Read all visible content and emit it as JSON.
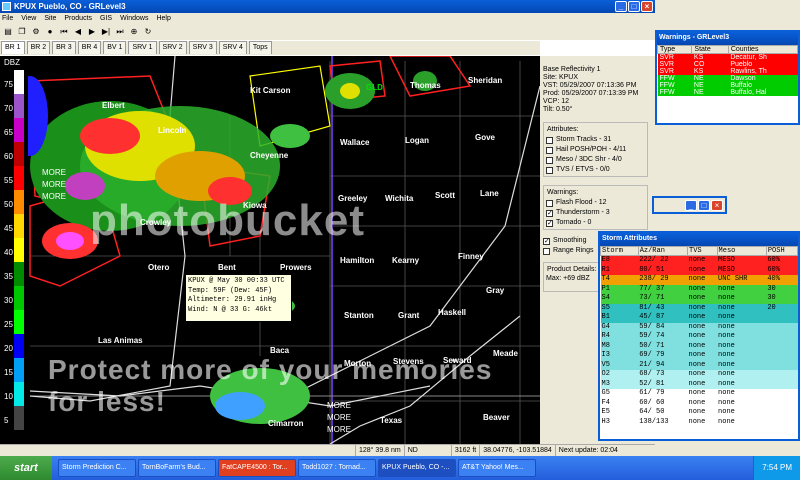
{
  "window": {
    "title": "KPUX Pueblo, CO - GRLevel3"
  },
  "menu": [
    "File",
    "View",
    "Site",
    "Products",
    "GIS",
    "Windows",
    "Help"
  ],
  "tabs": [
    "BR 1",
    "BR 2",
    "BR 3",
    "BR 4",
    "BV 1",
    "SRV 1",
    "SRV 2",
    "SRV 3",
    "SRV 4",
    "Tops"
  ],
  "colorbar": {
    "unit": "DBZ",
    "ticks": [
      "75",
      "70",
      "65",
      "60",
      "55",
      "50",
      "45",
      "40",
      "35",
      "30",
      "25",
      "20",
      "15",
      "10",
      "5"
    ]
  },
  "counties": [
    "Kit Carson",
    "Elbert",
    "Lincoln",
    "Cheyenne",
    "Wallace",
    "Logan",
    "Gove",
    "Thomas",
    "Sheridan",
    "Greeley",
    "Wichita",
    "Scott",
    "Lane",
    "Crowley",
    "Kiowa",
    "Otero",
    "Bent",
    "Prowers",
    "Hamilton",
    "Kearny",
    "Finney",
    "Gray",
    "Stanton",
    "Grant",
    "Haskell",
    "Las Animas",
    "Baca",
    "Morton",
    "Stevens",
    "Seward",
    "Meade",
    "Cimarron",
    "Texas",
    "Beaver"
  ],
  "map_cities": [
    "GLD"
  ],
  "tooltip": {
    "line1": "KPUX @ May 30 00:33 UTC",
    "line2": "Temp: 59F (Dew: 45F)",
    "line3": "Altimeter: 29.91 inHg",
    "line4": "Wind: N @ 33 G: 46kt"
  },
  "side": {
    "product": "Base Reflectivity 1",
    "site": "Site:  KPUX",
    "vst": "VST:  05/29/2007 07:13:36 PM",
    "prod": "Prod: 05/29/2007 07:13:39 PM",
    "vcp": "VCP:  12",
    "tilt": "Tilt:  0.50°",
    "attributes_caption": "Attributes:",
    "attributes": [
      "Storm Tracks - 31",
      "Hail POSH/POH - 4/11",
      "Meso / 3DC Shr - 4/0",
      "TVS / ETVS - 0/0"
    ],
    "warnings_caption": "Warnings:",
    "warnings": [
      "Flash Flood - 12",
      "Thunderstorm - 3",
      "Tornado - 0"
    ],
    "warnings_checked": [
      false,
      true,
      true
    ],
    "smoothing": "Smoothing",
    "range_rings": "Range Rings",
    "details_caption": "Product Details:",
    "details_max": "Max:  +69 dBZ"
  },
  "status": [
    "128° 39.8 nm",
    "ND",
    "3162 ft",
    "38.04776, -103.51884",
    "Next update: 02:04"
  ],
  "warnings_window": {
    "title": "Warnings - GRLevel3",
    "headers": [
      "Type",
      "State",
      "Counties"
    ],
    "rows": [
      {
        "type": "SVR",
        "state": "KS",
        "counties": "Decatur, Sh",
        "color": "#ff0000"
      },
      {
        "type": "SVR",
        "state": "CO",
        "counties": "Pueblo",
        "color": "#ff0000"
      },
      {
        "type": "SVR",
        "state": "KS",
        "counties": "Rawlins, Th",
        "color": "#ff0000"
      },
      {
        "type": "FFW",
        "state": "NE",
        "counties": "Dawson",
        "color": "#00cc00"
      },
      {
        "type": "FFW",
        "state": "NE",
        "counties": "Buffalo",
        "color": "#00cc00"
      },
      {
        "type": "FFW",
        "state": "NE",
        "counties": "Buffalo, Hal",
        "color": "#00cc00"
      }
    ]
  },
  "storm_window": {
    "title": "Storm Attributes",
    "headers": [
      "Storm",
      "Az/Ran",
      "TVS",
      "Meso",
      "POSH"
    ],
    "rows": [
      {
        "storm": "E8",
        "azran": "222/ 22",
        "tvs": "none",
        "meso": "MESO",
        "posh": "60%",
        "bg": "#ff2020"
      },
      {
        "storm": "R1",
        "azran": "80/ 51",
        "tvs": "none",
        "meso": "MESO",
        "posh": "60%",
        "bg": "#ff2020"
      },
      {
        "storm": "T4",
        "azran": "238/ 29",
        "tvs": "none",
        "meso": "UNC SHR",
        "posh": "40%",
        "bg": "#f0a000"
      },
      {
        "storm": "P1",
        "azran": "77/ 37",
        "tvs": "none",
        "meso": "none",
        "posh": "30",
        "bg": "#40d040"
      },
      {
        "storm": "S4",
        "azran": "73/ 71",
        "tvs": "none",
        "meso": "none",
        "posh": "30",
        "bg": "#40d040"
      },
      {
        "storm": "S5",
        "azran": "81/ 43",
        "tvs": "none",
        "meso": "none",
        "posh": "20",
        "bg": "#30c0c0"
      },
      {
        "storm": "B1",
        "azran": "45/ 87",
        "tvs": "none",
        "meso": "none",
        "posh": "",
        "bg": "#30c0c0"
      },
      {
        "storm": "G4",
        "azran": "59/ 84",
        "tvs": "none",
        "meso": "none",
        "posh": "",
        "bg": "#80e0e0"
      },
      {
        "storm": "R4",
        "azran": "59/ 74",
        "tvs": "none",
        "meso": "none",
        "posh": "",
        "bg": "#80e0e0"
      },
      {
        "storm": "M8",
        "azran": "50/ 71",
        "tvs": "none",
        "meso": "none",
        "posh": "",
        "bg": "#80e0e0"
      },
      {
        "storm": "I3",
        "azran": "69/ 79",
        "tvs": "none",
        "meso": "none",
        "posh": "",
        "bg": "#80e0e0"
      },
      {
        "storm": "V5",
        "azran": "21/ 94",
        "tvs": "none",
        "meso": "none",
        "posh": "",
        "bg": "#80e0e0"
      },
      {
        "storm": "O2",
        "azran": "68/ 73",
        "tvs": "none",
        "meso": "none",
        "posh": "",
        "bg": "#b0f0f0"
      },
      {
        "storm": "M3",
        "azran": "52/ 81",
        "tvs": "none",
        "meso": "none",
        "posh": "",
        "bg": "#b0f0f0"
      },
      {
        "storm": "G5",
        "azran": "61/ 79",
        "tvs": "none",
        "meso": "none",
        "posh": "",
        "bg": "#ffffff"
      },
      {
        "storm": "F4",
        "azran": "60/ 60",
        "tvs": "none",
        "meso": "none",
        "posh": "",
        "bg": "#ffffff"
      },
      {
        "storm": "E5",
        "azran": "64/ 50",
        "tvs": "none",
        "meso": "none",
        "posh": "",
        "bg": "#ffffff"
      },
      {
        "storm": "H3",
        "azran": "138/133",
        "tvs": "none",
        "meso": "none",
        "posh": "",
        "bg": "#ffffff"
      }
    ]
  },
  "taskbar": {
    "start": "start",
    "items": [
      "Storm Prediction C...",
      "TornBoFarm's Bud...",
      "FatCAPE4500 : Tor...",
      "Todd1027 : Tornad...",
      "KPUX Pueblo, CO -...",
      "AT&T Yahoo! Mes..."
    ],
    "clock": "7:54 PM"
  },
  "map_labels": {
    "more": "MORE"
  },
  "watermark": {
    "logo": "photobucket",
    "tagline": "Protect more of your memories for less!"
  }
}
